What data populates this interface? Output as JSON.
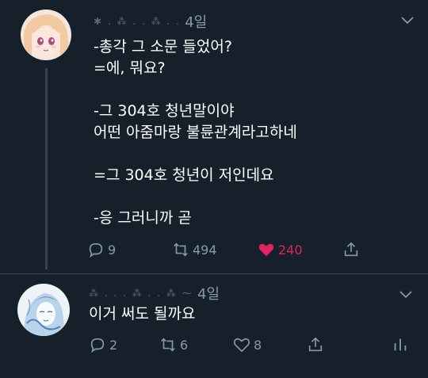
{
  "main_tweet": {
    "author_blurred": "✱ . ⁂ . . ⁂ . .",
    "time": "4일",
    "lines": [
      "-총각 그 소문 들었어?",
      "=에, 뭐요?",
      "",
      "-그 304호 청년말이야",
      "어떤 아줌마랑 불륜관계라고하네",
      "",
      "=그 304호 청년이 저인데요",
      "",
      "-응 그러니까 곧"
    ],
    "actions": {
      "reply_count": "9",
      "retweet_count": "494",
      "like_count": "240"
    }
  },
  "reply_tweet": {
    "author_blurred": "⁂ . . . ⁂ . . ⁂ ⁓",
    "time": "4일",
    "text": "이거 써도 될까요",
    "actions": {
      "reply_count": "2",
      "retweet_count": "6",
      "like_count": "8"
    }
  },
  "colors": {
    "background": "#15202b",
    "muted": "#8899a6",
    "like": "#e0245e",
    "divider": "#38444d"
  },
  "icons": [
    "reply-icon",
    "retweet-icon",
    "like-icon",
    "share-icon",
    "analytics-icon",
    "chevron-down-icon"
  ]
}
